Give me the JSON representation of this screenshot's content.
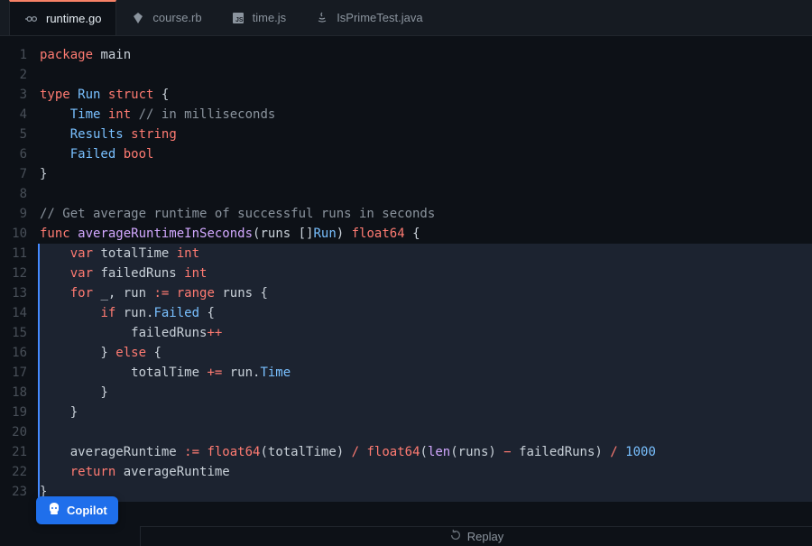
{
  "tabs": [
    {
      "label": "runtime.go",
      "active": true,
      "icon": "go-icon"
    },
    {
      "label": "course.rb",
      "active": false,
      "icon": "ruby-icon"
    },
    {
      "label": "time.js",
      "active": false,
      "icon": "js-icon"
    },
    {
      "label": "IsPrimeTest.java",
      "active": false,
      "icon": "java-icon"
    }
  ],
  "lines": [
    1,
    2,
    3,
    4,
    5,
    6,
    7,
    8,
    9,
    10,
    11,
    12,
    13,
    14,
    15,
    16,
    17,
    18,
    19,
    20,
    21,
    22,
    23
  ],
  "code": {
    "l1": [
      [
        "kw",
        "package"
      ],
      [
        "id",
        " main"
      ]
    ],
    "l2": [
      [
        "id",
        ""
      ]
    ],
    "l3": [
      [
        "kw",
        "type"
      ],
      [
        "id",
        " "
      ],
      [
        "fd",
        "Run"
      ],
      [
        "id",
        " "
      ],
      [
        "kw",
        "struct"
      ],
      [
        "id",
        " {"
      ]
    ],
    "l4": [
      [
        "id",
        "    "
      ],
      [
        "fd",
        "Time"
      ],
      [
        "id",
        " "
      ],
      [
        "ty",
        "int"
      ],
      [
        "id",
        " "
      ],
      [
        "cm",
        "// in milliseconds"
      ]
    ],
    "l5": [
      [
        "id",
        "    "
      ],
      [
        "fd",
        "Results"
      ],
      [
        "id",
        " "
      ],
      [
        "ty",
        "string"
      ]
    ],
    "l6": [
      [
        "id",
        "    "
      ],
      [
        "fd",
        "Failed"
      ],
      [
        "id",
        " "
      ],
      [
        "ty",
        "bool"
      ]
    ],
    "l7": [
      [
        "id",
        "}"
      ]
    ],
    "l8": [
      [
        "id",
        ""
      ]
    ],
    "l9": [
      [
        "cm",
        "// Get average runtime of successful runs in seconds"
      ]
    ],
    "l10": [
      [
        "kw",
        "func"
      ],
      [
        "id",
        " "
      ],
      [
        "fn",
        "averageRuntimeInSeconds"
      ],
      [
        "pn",
        "(runs []"
      ],
      [
        "fd",
        "Run"
      ],
      [
        "pn",
        ") "
      ],
      [
        "ty",
        "float64"
      ],
      [
        "pn",
        " {"
      ]
    ],
    "l11": [
      [
        "id",
        "    "
      ],
      [
        "kw",
        "var"
      ],
      [
        "id",
        " totalTime "
      ],
      [
        "ty",
        "int"
      ]
    ],
    "l12": [
      [
        "id",
        "    "
      ],
      [
        "kw",
        "var"
      ],
      [
        "id",
        " failedRuns "
      ],
      [
        "ty",
        "int"
      ]
    ],
    "l13": [
      [
        "id",
        "    "
      ],
      [
        "kw",
        "for"
      ],
      [
        "id",
        " _, run "
      ],
      [
        "op",
        ":="
      ],
      [
        "id",
        " "
      ],
      [
        "kw",
        "range"
      ],
      [
        "id",
        " runs {"
      ]
    ],
    "l14": [
      [
        "id",
        "        "
      ],
      [
        "kw",
        "if"
      ],
      [
        "id",
        " run."
      ],
      [
        "fd",
        "Failed"
      ],
      [
        "id",
        " {"
      ]
    ],
    "l15": [
      [
        "id",
        "            failedRuns"
      ],
      [
        "op",
        "++"
      ]
    ],
    "l16": [
      [
        "id",
        "        } "
      ],
      [
        "kw",
        "else"
      ],
      [
        "id",
        " {"
      ]
    ],
    "l17": [
      [
        "id",
        "            totalTime "
      ],
      [
        "op",
        "+="
      ],
      [
        "id",
        " run."
      ],
      [
        "fd",
        "Time"
      ]
    ],
    "l18": [
      [
        "id",
        "        }"
      ]
    ],
    "l19": [
      [
        "id",
        "    }"
      ]
    ],
    "l20": [
      [
        "id",
        ""
      ]
    ],
    "l21": [
      [
        "id",
        "    averageRuntime "
      ],
      [
        "op",
        ":="
      ],
      [
        "id",
        " "
      ],
      [
        "ty",
        "float64"
      ],
      [
        "pn",
        "(totalTime) "
      ],
      [
        "op",
        "/"
      ],
      [
        "id",
        " "
      ],
      [
        "ty",
        "float64"
      ],
      [
        "pn",
        "("
      ],
      [
        "fn",
        "len"
      ],
      [
        "pn",
        "(runs) "
      ],
      [
        "op",
        "−"
      ],
      [
        "id",
        " failedRuns) "
      ],
      [
        "op",
        "/"
      ],
      [
        "id",
        " "
      ],
      [
        "nm",
        "1000"
      ]
    ],
    "l22": [
      [
        "id",
        "    "
      ],
      [
        "kw",
        "return"
      ],
      [
        "id",
        " averageRuntime"
      ]
    ],
    "l23": [
      [
        "id",
        "}"
      ]
    ]
  },
  "highlighted_lines": [
    11,
    12,
    13,
    14,
    15,
    16,
    17,
    18,
    19,
    20,
    21,
    22,
    23
  ],
  "copilot": {
    "label": "Copilot"
  },
  "footer": {
    "label": "Replay"
  }
}
